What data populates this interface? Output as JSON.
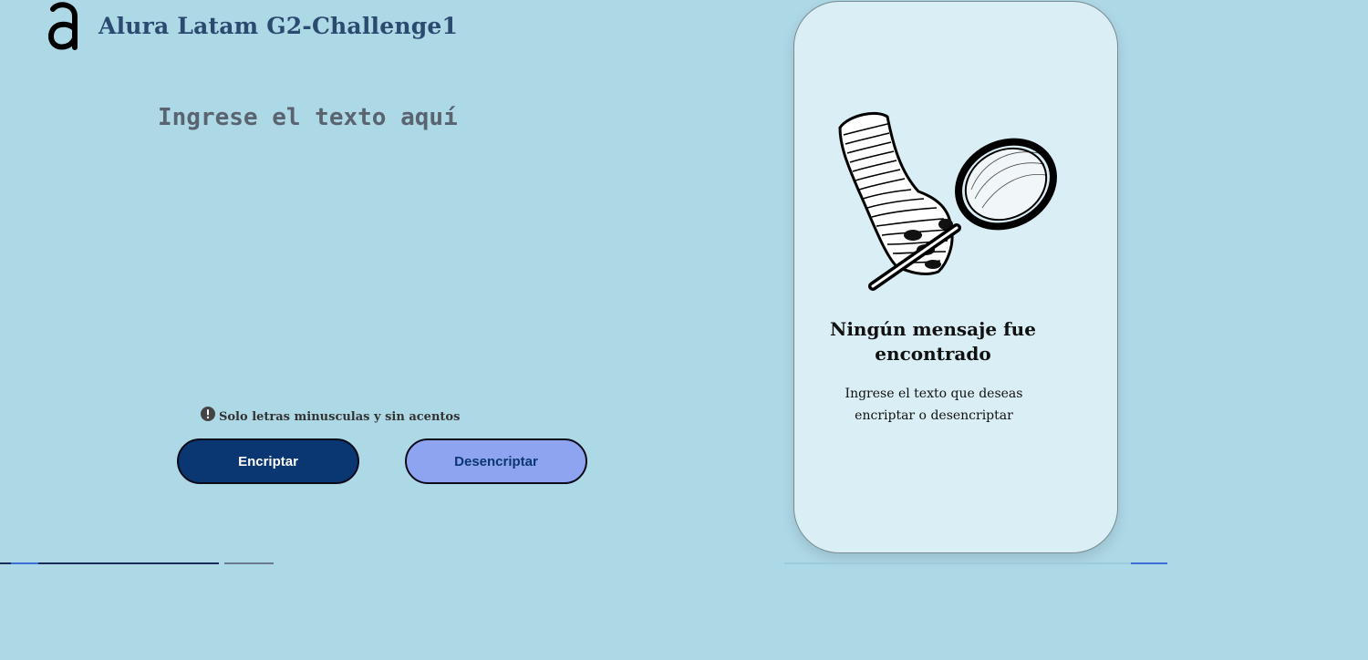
{
  "header": {
    "title": "Alura Latam G2-Challenge1",
    "logo_icon": "alura-a-logo-icon"
  },
  "input": {
    "placeholder": "Ingrese el texto aquí",
    "value": ""
  },
  "hint": {
    "icon": "exclamation-circle-icon",
    "text": "Solo letras minusculas y sin acentos"
  },
  "actions": {
    "encrypt_label": "Encriptar",
    "decrypt_label": "Desencriptar"
  },
  "output": {
    "illustration": "hand-magnifying-glass-icon",
    "title": "Ningún mensaje fue encontrado",
    "message": "Ingrese el texto que deseas encriptar o desencriptar"
  },
  "colors": {
    "background": "#add8e6",
    "title": "#2b4a6f",
    "encrypt_button": "#0a3671",
    "decrypt_button": "#8fa4f0",
    "card": "#daeef5"
  }
}
